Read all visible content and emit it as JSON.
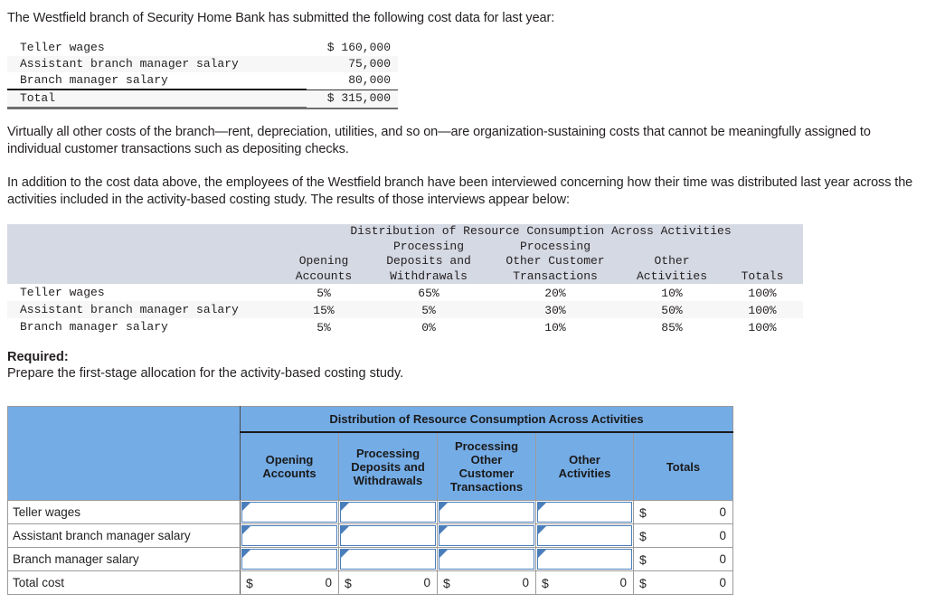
{
  "intro": {
    "paragraph": "The Westfield branch of Security Home Bank has submitted the following cost data for last year:"
  },
  "cost_data_table": {
    "rows": [
      {
        "label": "Teller wages",
        "currency": "$",
        "amount": "160,000"
      },
      {
        "label": "Assistant branch manager salary",
        "currency": "",
        "amount": "75,000"
      },
      {
        "label": "Branch manager salary",
        "currency": "",
        "amount": "80,000"
      },
      {
        "label": "Total",
        "currency": "$",
        "amount": "315,000"
      }
    ]
  },
  "body": {
    "org_sustaining": "Virtually all other costs of the branch—rent, depreciation, utilities, and so on—are organization-sustaining costs that cannot be meaningfully assigned to individual customer transactions such as depositing checks.",
    "interviews": "In addition to the cost data above, the employees of the Westfield branch have been interviewed concerning how their time was distributed last year across the activities included in the activity-based costing study. The results of those interviews appear below:"
  },
  "distribution_table": {
    "group_header": "Distribution of Resource Consumption Across Activities",
    "column_headers": [
      {
        "line1": "",
        "line2": "Opening",
        "line3": "Accounts"
      },
      {
        "line1": "Processing",
        "line2": "Deposits and",
        "line3": "Withdrawals"
      },
      {
        "line1": "Processing",
        "line2": "Other Customer",
        "line3": "Transactions"
      },
      {
        "line1": "",
        "line2": "Other",
        "line3": "Activities"
      },
      {
        "line1": "",
        "line2": "",
        "line3": "Totals"
      }
    ],
    "rows": [
      {
        "label": "Teller wages",
        "opening_accounts": "5%",
        "deposits_withdrawals": "65%",
        "other_customer": "20%",
        "other_activities": "10%",
        "totals": "100%"
      },
      {
        "label": "Assistant branch manager salary",
        "opening_accounts": "15%",
        "deposits_withdrawals": "5%",
        "other_customer": "30%",
        "other_activities": "50%",
        "totals": "100%"
      },
      {
        "label": "Branch manager salary",
        "opening_accounts": "5%",
        "deposits_withdrawals": "0%",
        "other_customer": "10%",
        "other_activities": "85%",
        "totals": "100%"
      }
    ]
  },
  "required": {
    "heading": "Required:",
    "instruction": "Prepare the first-stage allocation for the activity-based costing study."
  },
  "answer_table": {
    "group_header": "Distribution of Resource Consumption Across Activities",
    "column_headers": [
      "Opening Accounts",
      "Processing Deposits and Withdrawals",
      "Processing Other Customer Transactions",
      "Other Activities",
      "Totals"
    ],
    "column_header_lines": [
      [
        "Opening",
        "Accounts"
      ],
      [
        "Processing",
        "Deposits and",
        "Withdrawals"
      ],
      [
        "Processing",
        "Other",
        "Customer",
        "Transactions"
      ],
      [
        "Other",
        "Activities"
      ],
      [
        "Totals"
      ]
    ],
    "rows": [
      {
        "label": "Teller wages",
        "opening_accounts": "",
        "deposits_withdrawals": "",
        "other_customer": "",
        "other_activities": "",
        "totals_currency": "$",
        "totals_value": "0"
      },
      {
        "label": "Assistant branch manager salary",
        "opening_accounts": "",
        "deposits_withdrawals": "",
        "other_customer": "",
        "other_activities": "",
        "totals_currency": "$",
        "totals_value": "0"
      },
      {
        "label": "Branch manager salary",
        "opening_accounts": "",
        "deposits_withdrawals": "",
        "other_customer": "",
        "other_activities": "",
        "totals_currency": "$",
        "totals_value": "0"
      }
    ],
    "total_row": {
      "label": "Total cost",
      "cells": [
        {
          "currency": "$",
          "value": "0"
        },
        {
          "currency": "$",
          "value": "0"
        },
        {
          "currency": "$",
          "value": "0"
        },
        {
          "currency": "$",
          "value": "0"
        },
        {
          "currency": "$",
          "value": "0"
        }
      ]
    }
  },
  "colors": {
    "answer_header_blue": "#74ace6",
    "entry_border_blue": "#4a7ebb",
    "distribution_header_gray": "#d5d9e3",
    "alt_row": "#f7f7f7",
    "text": "#231f20"
  }
}
